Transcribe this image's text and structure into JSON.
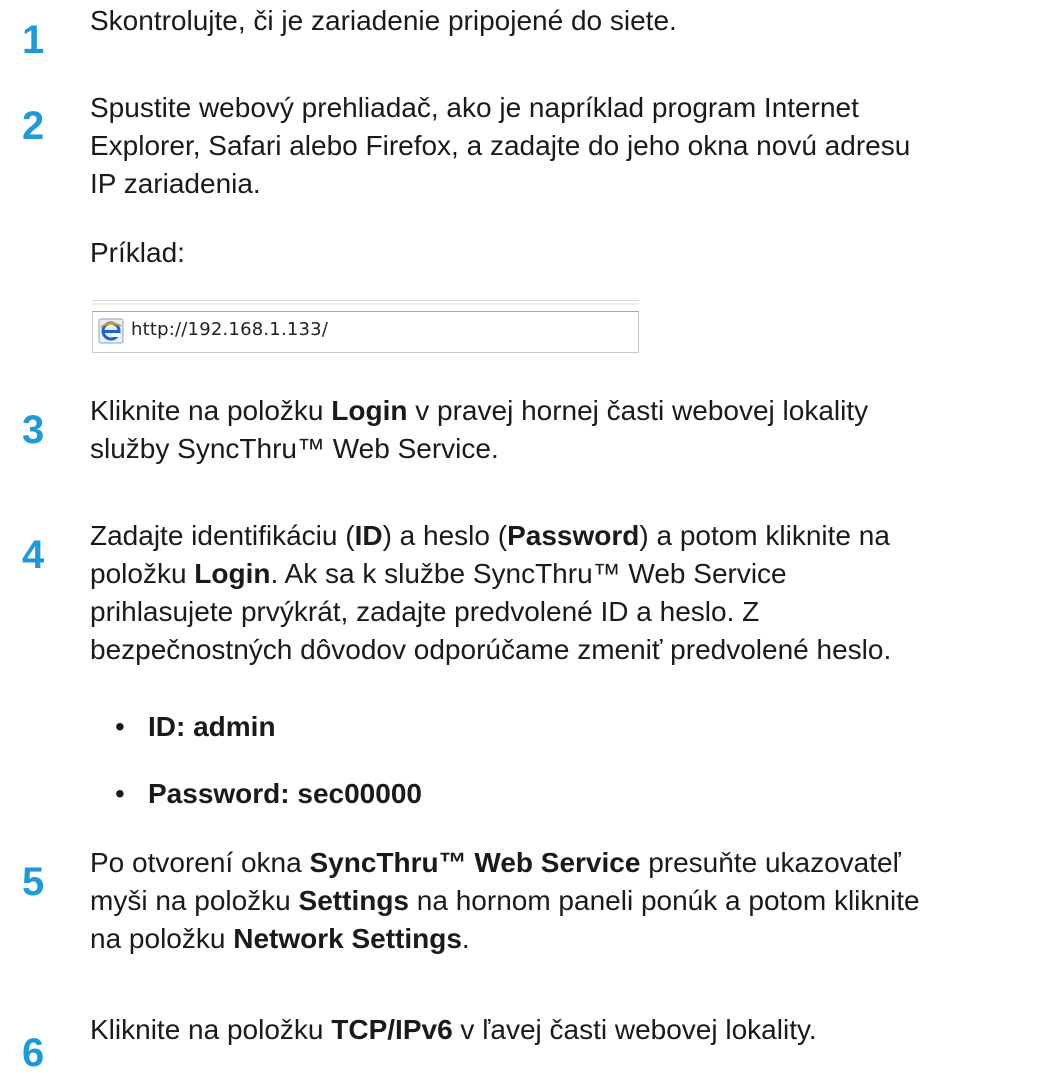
{
  "steps": [
    {
      "number": "1",
      "lines": [
        "Skontrolujte, či je zariadenie pripojené do siete."
      ]
    },
    {
      "number": "2",
      "lines": [
        "Spustite webový prehliadač, ako je napríklad program Internet",
        "Explorer, Safari alebo Firefox, a zadajte do jeho okna novú adresu",
        "IP zariadenia."
      ]
    },
    {
      "number": "3"
    },
    {
      "number": "4"
    },
    {
      "number": "5"
    },
    {
      "number": "6"
    }
  ],
  "example_label": "Príklad:",
  "address_bar": {
    "url": "http://192.168.1.133/",
    "icon": "ie-browser-icon"
  },
  "step3": {
    "t1": "Kliknite na položku ",
    "b1": "Login",
    "t2": " v pravej hornej časti webovej lokality",
    "line2": "služby SyncThru™ Web Service."
  },
  "step4": {
    "t1": "Zadajte identifikáciu (",
    "b1": "ID",
    "t2": ") a heslo (",
    "b2": "Password",
    "t3": ") a potom kliknite na",
    "t4": "položku ",
    "b3": "Login",
    "t5": ". Ak sa k službe SyncThru™ Web Service",
    "line3": "prihlasujete prvýkrát, zadajte predvolené ID a heslo. Z",
    "line4": "bezpečnostných dôvodov odporúčame zmeniť predvolené heslo.",
    "bullets": [
      "ID: admin",
      "Password: sec00000"
    ],
    "bullet_char": "•"
  },
  "step5": {
    "t1": "Po otvorení okna ",
    "b1": "SyncThru™ Web Service",
    "t2": " presuňte ukazovateľ",
    "t3": "myši na položku ",
    "b2": "Settings",
    "t4": " na hornom paneli ponúk a potom kliknite",
    "t5": "na položku ",
    "b3": "Network Settings",
    "t6": "."
  },
  "step6": {
    "t1": "Kliknite na položku ",
    "b1": "TCP/IPv6",
    "t2": " v ľavej časti webovej lokality."
  },
  "colors": {
    "step_number": "#1f9ad6",
    "text": "#1a1a1a"
  }
}
